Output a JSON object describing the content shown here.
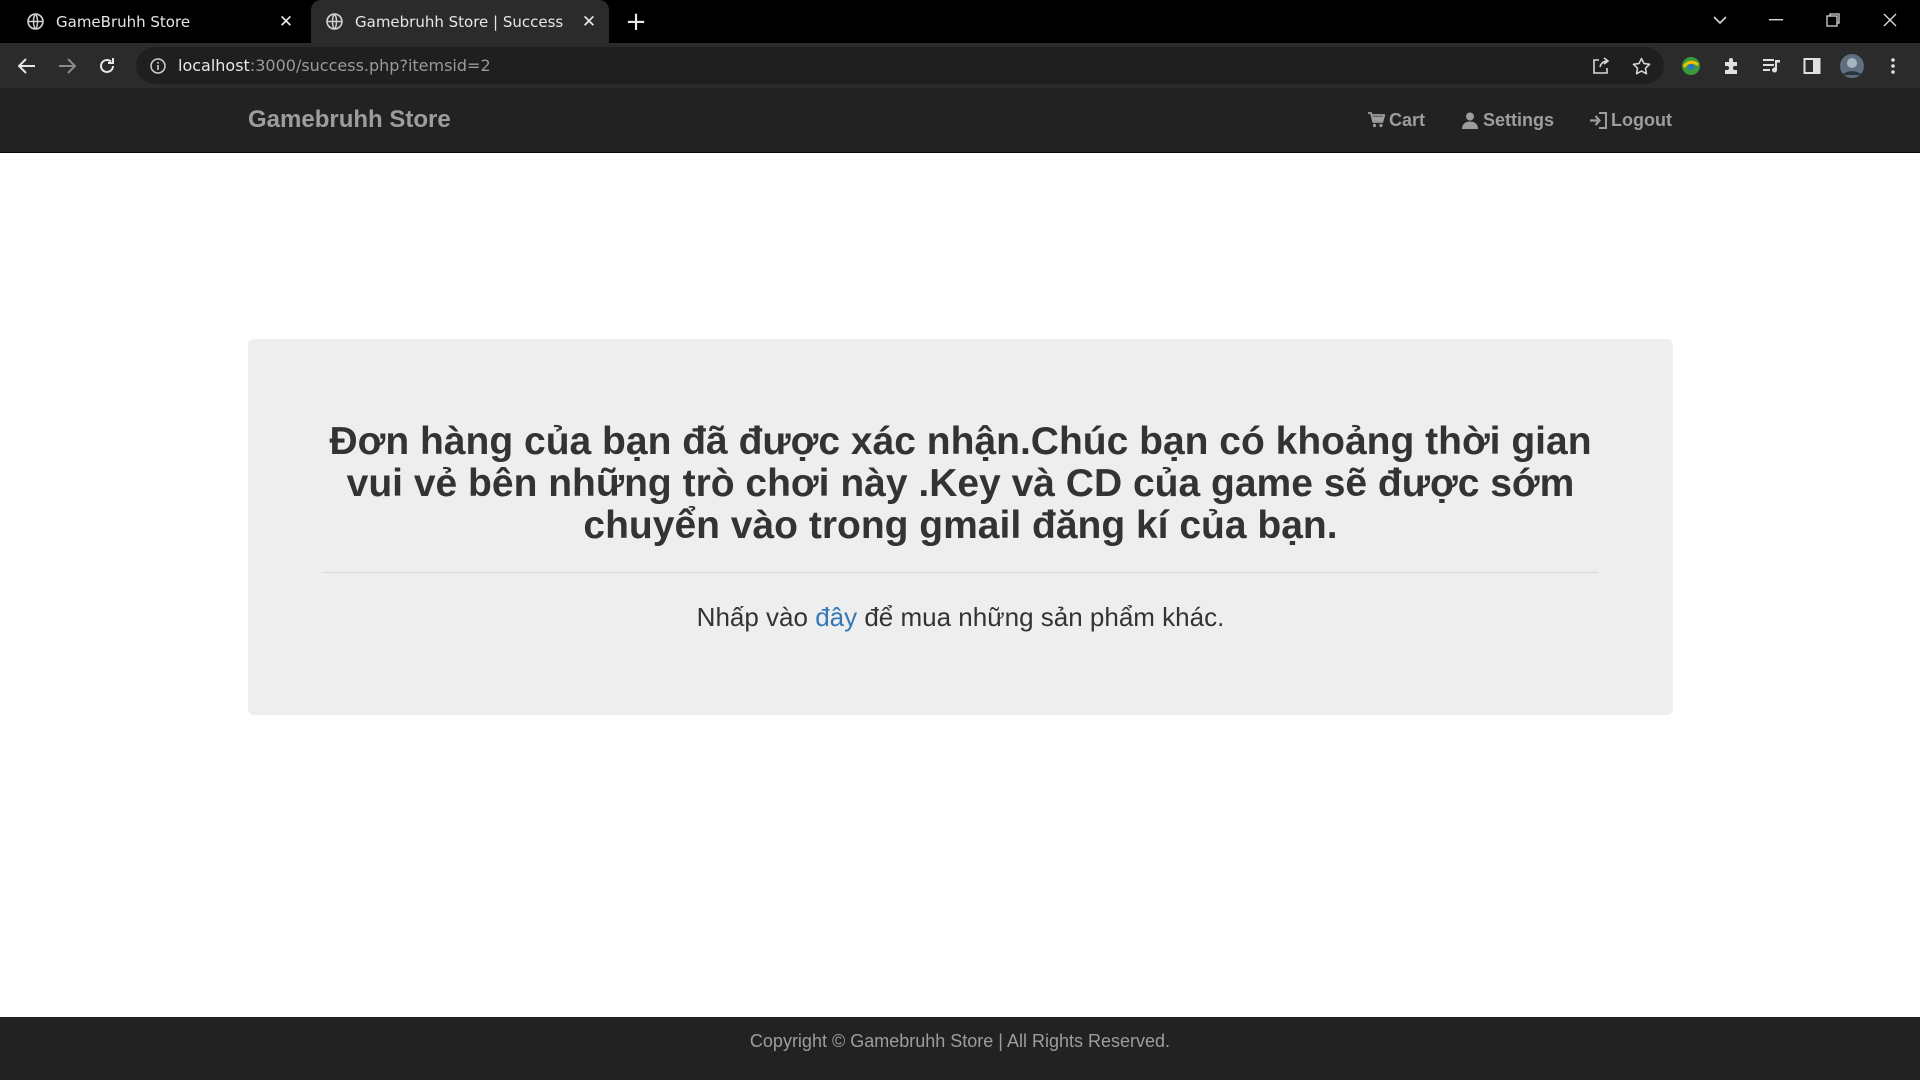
{
  "browser": {
    "tabs": [
      {
        "title": "GameBruhh Store",
        "active": false
      },
      {
        "title": "Gamebruhh Store | Success",
        "active": true
      }
    ],
    "url_host": "localhost",
    "url_rest": ":3000/success.php?itemsid=2"
  },
  "navbar": {
    "brand": "Gamebruhh Store",
    "links": [
      {
        "label": "Cart",
        "icon": "shopping-cart-icon"
      },
      {
        "label": "Settings",
        "icon": "user-icon"
      },
      {
        "label": "Logout",
        "icon": "log-in-icon"
      }
    ]
  },
  "main": {
    "headline": "Đơn hàng của bạn đã được xác nhận.Chúc bạn có khoảng thời gian vui vẻ bên những trò chơi này .Key và CD của game sẽ được sớm chuyển vào trong gmail đăng kí của bạn.",
    "sub_before": "Nhấp vào ",
    "sub_link": "đây",
    "sub_after": " để mua những sản phẩm khác."
  },
  "footer": {
    "text": "Copyright © Gamebruhh Store | All Rights Reserved."
  },
  "colors": {
    "navbar_bg": "#222222",
    "nav_text": "#9d9d9d",
    "jumbotron_bg": "#eeeeee",
    "link": "#337ab7"
  }
}
